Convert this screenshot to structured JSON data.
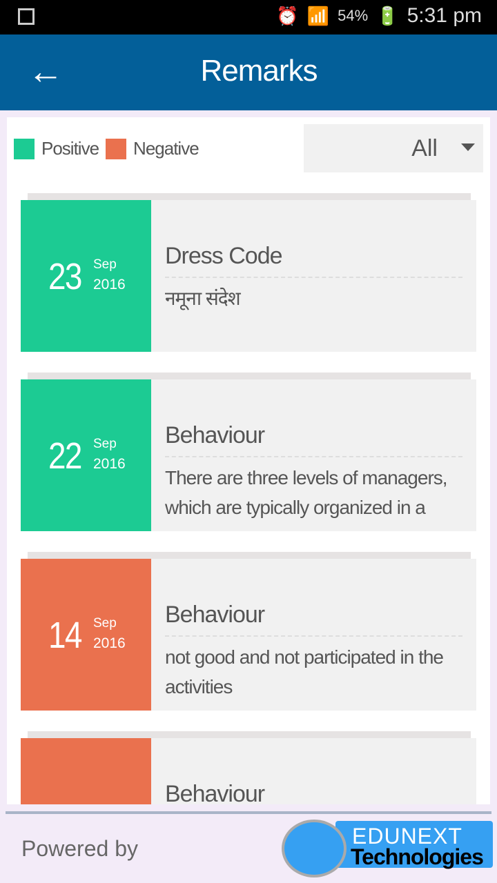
{
  "status_bar": {
    "battery": "54%",
    "time": "5:31 pm",
    "icons": [
      "gallery-icon",
      "alarm-icon",
      "wifi-icon",
      "signal-icon",
      "battery-charging-icon"
    ]
  },
  "header": {
    "title": "Remarks",
    "back_icon": "arrow-left-icon"
  },
  "legend": [
    {
      "label": "Positive",
      "color": "#1ccb93"
    },
    {
      "label": "Negative",
      "color": "#ea714e"
    }
  ],
  "filter": {
    "selected": "All"
  },
  "remarks": [
    {
      "day": "23",
      "month": "Sep",
      "year": "2016",
      "type": "positive",
      "title": "Dress Code",
      "message": "नमूना संदेश"
    },
    {
      "day": "22",
      "month": "Sep",
      "year": "2016",
      "type": "positive",
      "title": "Behaviour",
      "message": "There are three levels of managers, which are typically organized in a"
    },
    {
      "day": "14",
      "month": "Sep",
      "year": "2016",
      "type": "negative",
      "title": "Behaviour",
      "message": "not good and not participated in the activities"
    },
    {
      "day": "",
      "month": "",
      "year": "",
      "type": "negative",
      "title": "Behaviour",
      "message": ""
    }
  ],
  "footer": {
    "powered_by": "Powered by",
    "logo_line1": "EDUNEXT",
    "logo_line2": "Technologies"
  }
}
